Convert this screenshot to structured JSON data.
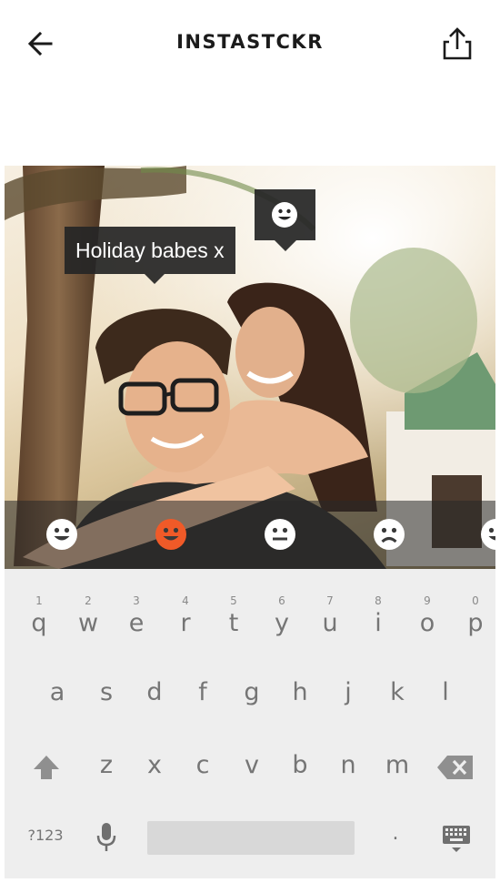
{
  "header": {
    "title": "INSTASTCKR",
    "back_icon": "arrow-left-icon",
    "share_icon": "share-upload-icon"
  },
  "photo": {
    "caption_sticker": "Holiday babes x",
    "emoji_sticker_icon": "smiley-face-icon"
  },
  "emoji_tray": {
    "items": [
      {
        "icon": "smiley-icon",
        "color": "#ffffff",
        "selected": false
      },
      {
        "icon": "smiley-icon",
        "color": "#f05a28",
        "selected": true
      },
      {
        "icon": "neutral-face-icon",
        "color": "#ffffff",
        "selected": false
      },
      {
        "icon": "sad-face-icon",
        "color": "#ffffff",
        "selected": false
      },
      {
        "icon": "smiley-partial-icon",
        "color": "#ffffff",
        "selected": false
      }
    ]
  },
  "keyboard": {
    "row1": [
      {
        "ch": "q",
        "hint": "1"
      },
      {
        "ch": "w",
        "hint": "2"
      },
      {
        "ch": "e",
        "hint": "3"
      },
      {
        "ch": "r",
        "hint": "4"
      },
      {
        "ch": "t",
        "hint": "5"
      },
      {
        "ch": "y",
        "hint": "6"
      },
      {
        "ch": "u",
        "hint": "7"
      },
      {
        "ch": "i",
        "hint": "8"
      },
      {
        "ch": "o",
        "hint": "9"
      },
      {
        "ch": "p",
        "hint": "0"
      }
    ],
    "row2": [
      "a",
      "s",
      "d",
      "f",
      "g",
      "h",
      "j",
      "k",
      "l"
    ],
    "row3": [
      "z",
      "x",
      "c",
      "v",
      "b",
      "n",
      "m"
    ],
    "symbols_label": "?123",
    "period_label": ".",
    "shift_icon": "shift-arrow-icon",
    "backspace_icon": "backspace-icon",
    "mic_icon": "microphone-icon",
    "hide_keyboard_icon": "keyboard-hide-icon"
  }
}
